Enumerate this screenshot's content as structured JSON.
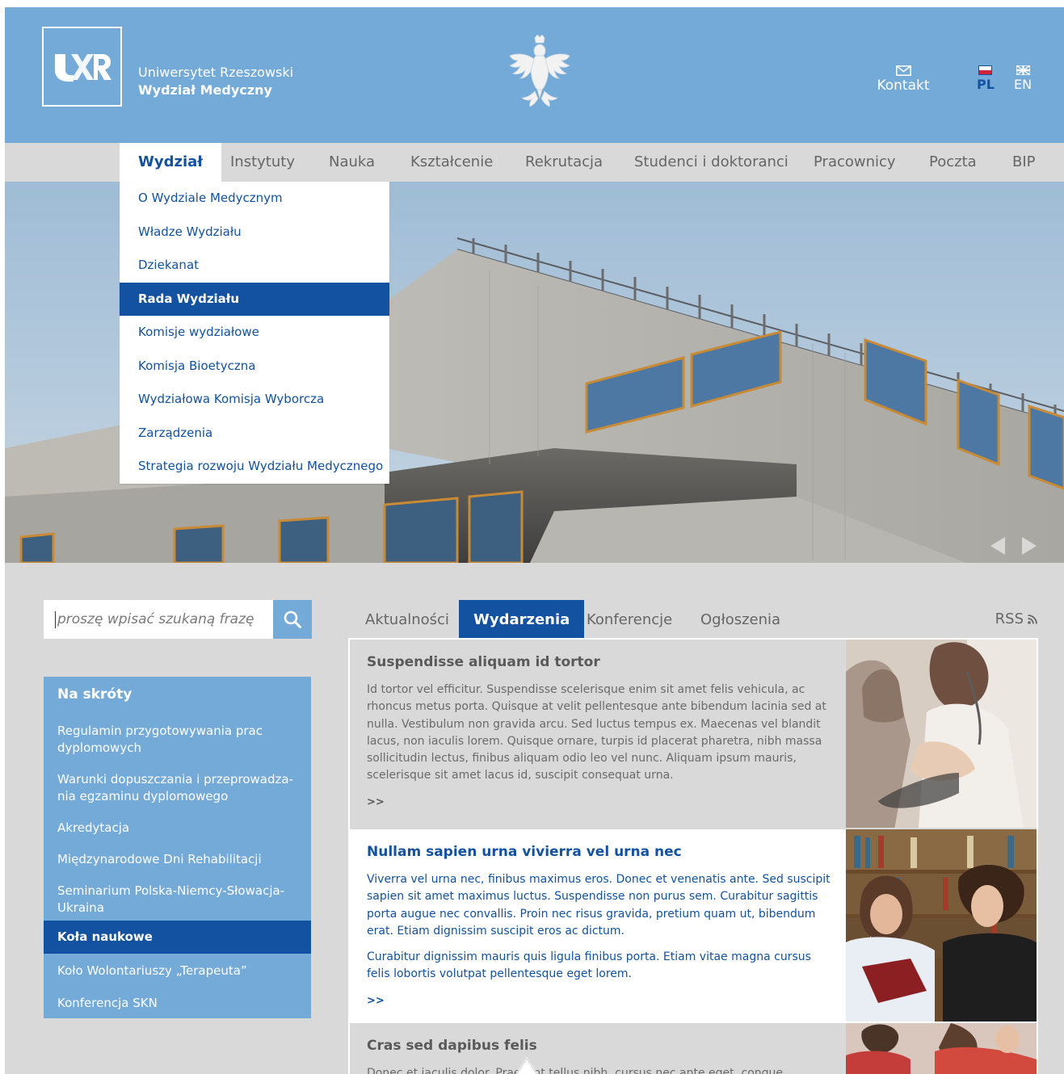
{
  "header": {
    "university": "Uniwersytet Rzeszowski",
    "faculty": "Wydział Medyczny",
    "logo_icon": "ur-logo",
    "emblem_icon": "polish-eagle-emblem",
    "contact_label": "Kontakt",
    "lang_pl": "PL",
    "lang_en": "EN"
  },
  "nav": {
    "items": [
      "Wydział",
      "Instytuty",
      "Nauka",
      "Kształcenie",
      "Rekrutacja",
      "Studenci i doktoranci",
      "Pracownicy",
      "Poczta",
      "BIP"
    ],
    "active": "Wydział"
  },
  "dropdown": {
    "items": [
      "O Wydziale Medycznym",
      "Władze Wydziału",
      "Dziekanat",
      "Rada Wydziału",
      "Komisje wydziałowe",
      "Komisja Bioetyczna",
      "Wydziałowa Komisja Wyborcza",
      "Zarządzenia",
      "Strategia rozwoju Wydziału Medycznego"
    ],
    "active": "Rada Wydziału"
  },
  "search": {
    "placeholder": "proszę wpisać szukaną frazę"
  },
  "shortcuts": {
    "title": "Na skróty",
    "items": [
      "Regulamin przygotowywania prac dyplomowych",
      "Warunki dopuszczania i przeprowadza-nia egzaminu dyplomowego",
      "Akredytacja",
      "Międzynarodowe Dni Rehabilitacji",
      "Seminarium Polska-Niemcy-Słowacja-Ukraina",
      "Koła naukowe",
      "Koło Wolontariuszy „Terapeuta”",
      "Konferencja SKN"
    ],
    "active": "Koła naukowe"
  },
  "tabs": {
    "items": [
      "Aktualności",
      "Wydarzenia",
      "Konferencje",
      "Ogłoszenia"
    ],
    "active": "Wydarzenia",
    "rss": "RSS"
  },
  "news": [
    {
      "title": "Suspendisse aliquam id tortor",
      "paragraphs": [
        "Id tortor vel efficitur. Suspendisse scelerisque enim sit amet felis vehicula, ac rhoncus metus porta. Quisque at velit pellentesque ante bibendum lacinia sed at nulla. Vestibulum non gravida arcu. Sed luctus tempus ex. Maecenas vel blandit lacus, non iaculis lorem. Quisque ornare, turpis id placerat pharetra, nibh massa sollicitudin lectus, finibus aliquam odio leo vel nunc. Aliquam ipsum mauris, scelerisque sit amet lacus id, suscipit consequat urna."
      ],
      "more": ">>"
    },
    {
      "title": "Nullam sapien urna vivierra vel urna nec",
      "paragraphs": [
        "Viverra vel urna nec, finibus maximus eros. Donec et venenatis ante. Sed suscipit sapien sit amet maximus luctus. Suspendisse non purus sem. Curabitur sagittis porta augue nec convallis. Proin nec risus gravida, pretium quam ut, bibendum erat. Etiam dignissim suscipit eros ac dictum.",
        "Curabitur dignissim mauris quis ligula finibus porta. Etiam vitae magna cursus felis lobortis volutpat pellentesque eget lorem."
      ],
      "more": ">>"
    },
    {
      "title": "Cras sed dapibus felis",
      "paragraphs": [
        "Donec et iaculis dolor. Praesent tellus nibh, cursus nec ante eget, conque"
      ],
      "more": ""
    }
  ],
  "colors": {
    "header_bg": "#74aad8",
    "accent_dark": "#1252a1",
    "page_bg": "#d9d9d9"
  }
}
